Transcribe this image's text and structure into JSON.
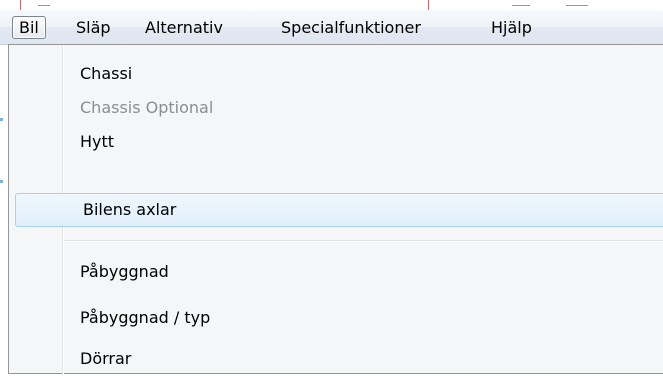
{
  "menubar": {
    "items": [
      {
        "label": "Bil",
        "state": "open"
      },
      {
        "label": "Släp",
        "state": "normal"
      },
      {
        "label": "Alternativ",
        "state": "normal"
      },
      {
        "label": "Specialfunktioner",
        "state": "normal"
      },
      {
        "label": "Hjälp",
        "state": "normal"
      }
    ]
  },
  "dropdown": {
    "items": [
      {
        "label": "Chassi",
        "state": "normal"
      },
      {
        "label": "Chassis Optional",
        "state": "disabled"
      },
      {
        "label": "Hytt",
        "state": "normal"
      },
      {
        "label": "Bilens axlar",
        "state": "hover"
      },
      {
        "label": "Påbyggnad",
        "state": "normal"
      },
      {
        "label": "Påbyggnad / typ",
        "state": "normal"
      },
      {
        "label": "Dörrar",
        "state": "normal"
      }
    ]
  },
  "colors": {
    "hover_border": "#a8d1f0",
    "hover_fill": "#dfeefb",
    "disabled_text": "#8d8d8d",
    "menu_background": "#f5f6f7"
  }
}
